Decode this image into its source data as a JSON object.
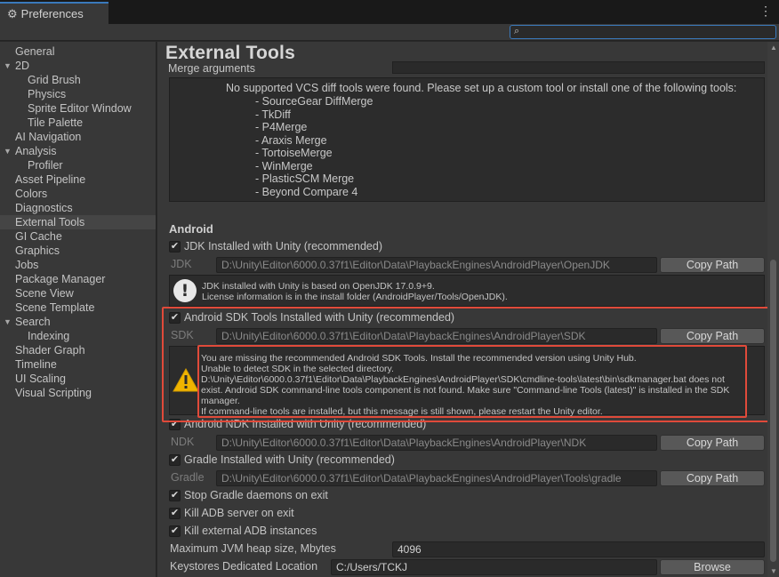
{
  "window": {
    "tab_title": "Preferences",
    "menu_icon": "kebab-menu-icon",
    "search_placeholder": ""
  },
  "sidebar": {
    "items": [
      {
        "label": "General",
        "level": 0
      },
      {
        "label": "2D",
        "level": 0,
        "expanded": true
      },
      {
        "label": "Grid Brush",
        "level": 1
      },
      {
        "label": "Physics",
        "level": 1
      },
      {
        "label": "Sprite Editor Window",
        "level": 1
      },
      {
        "label": "Tile Palette",
        "level": 1
      },
      {
        "label": "AI Navigation",
        "level": 0
      },
      {
        "label": "Analysis",
        "level": 0,
        "expanded": true
      },
      {
        "label": "Profiler",
        "level": 1
      },
      {
        "label": "Asset Pipeline",
        "level": 0
      },
      {
        "label": "Colors",
        "level": 0
      },
      {
        "label": "Diagnostics",
        "level": 0
      },
      {
        "label": "External Tools",
        "level": 0,
        "selected": true
      },
      {
        "label": "GI Cache",
        "level": 0
      },
      {
        "label": "Graphics",
        "level": 0
      },
      {
        "label": "Jobs",
        "level": 0
      },
      {
        "label": "Package Manager",
        "level": 0
      },
      {
        "label": "Scene View",
        "level": 0
      },
      {
        "label": "Scene Template",
        "level": 0
      },
      {
        "label": "Search",
        "level": 0,
        "expanded": true
      },
      {
        "label": "Indexing",
        "level": 1
      },
      {
        "label": "Shader Graph",
        "level": 0
      },
      {
        "label": "Timeline",
        "level": 0
      },
      {
        "label": "UI Scaling",
        "level": 0
      },
      {
        "label": "Visual Scripting",
        "level": 0
      }
    ]
  },
  "main": {
    "title": "External Tools",
    "merge_arguments_label": "Merge arguments",
    "merge_arguments_value": "",
    "vcs_message": "No supported VCS diff tools were found. Please set up a custom tool or install one of the following tools:",
    "vcs_tools": [
      "- SourceGear DiffMerge",
      "- TkDiff",
      "- P4Merge",
      "- Araxis Merge",
      "- TortoiseMerge",
      "- WinMerge",
      "- PlasticSCM Merge",
      "- Beyond Compare 4"
    ],
    "android": {
      "heading": "Android",
      "jdk_check_label": "JDK Installed with Unity (recommended)",
      "jdk_label": "JDK",
      "jdk_path": "D:\\Unity\\Editor\\6000.0.37f1\\Editor\\Data\\PlaybackEngines\\AndroidPlayer\\OpenJDK",
      "jdk_info_line1": "JDK installed with Unity is based on OpenJDK 17.0.9+9.",
      "jdk_info_line2": "License information is in the install folder (AndroidPlayer/Tools/OpenJDK).",
      "sdk_check_label": "Android SDK Tools Installed with Unity (recommended)",
      "sdk_label": "SDK",
      "sdk_path": "D:\\Unity\\Editor\\6000.0.37f1\\Editor\\Data\\PlaybackEngines\\AndroidPlayer\\SDK",
      "sdk_warning_lines": [
        "You are missing the recommended Android SDK Tools. Install the recommended version using Unity Hub.",
        "Unable to detect SDK in the selected directory.",
        "D:\\Unity\\Editor\\6000.0.37f1\\Editor\\Data\\PlaybackEngines\\AndroidPlayer\\SDK\\cmdline-tools\\latest\\bin\\sdkmanager.bat does not",
        "exist. Android SDK command-line tools component is not found. Make sure \"Command-line Tools (latest)\" is installed in the SDK",
        "manager.",
        "If command-line tools are installed, but this message is still shown, please restart the Unity editor."
      ],
      "ndk_check_label": "Android NDK Installed with Unity (recommended)",
      "ndk_label": "NDK",
      "ndk_path": "D:\\Unity\\Editor\\6000.0.37f1\\Editor\\Data\\PlaybackEngines\\AndroidPlayer\\NDK",
      "gradle_check_label": "Gradle Installed with Unity (recommended)",
      "gradle_label": "Gradle",
      "gradle_path": "D:\\Unity\\Editor\\6000.0.37f1\\Editor\\Data\\PlaybackEngines\\AndroidPlayer\\Tools\\gradle",
      "stop_gradle_label": "Stop Gradle daemons on exit",
      "kill_adb_label": "Kill ADB server on exit",
      "kill_ext_adb_label": "Kill external ADB instances",
      "jvm_label": "Maximum JVM heap size, Mbytes",
      "jvm_value": "4096",
      "keystores_label": "Keystores Dedicated Location",
      "keystores_value": "C:/Users/TCKJ",
      "copy_path_label": "Copy Path",
      "browse_label": "Browse",
      "checked": true
    }
  },
  "colors": {
    "highlight_box": "#e04a3a",
    "accent": "#3a79bb",
    "warning": "#f0b400"
  }
}
